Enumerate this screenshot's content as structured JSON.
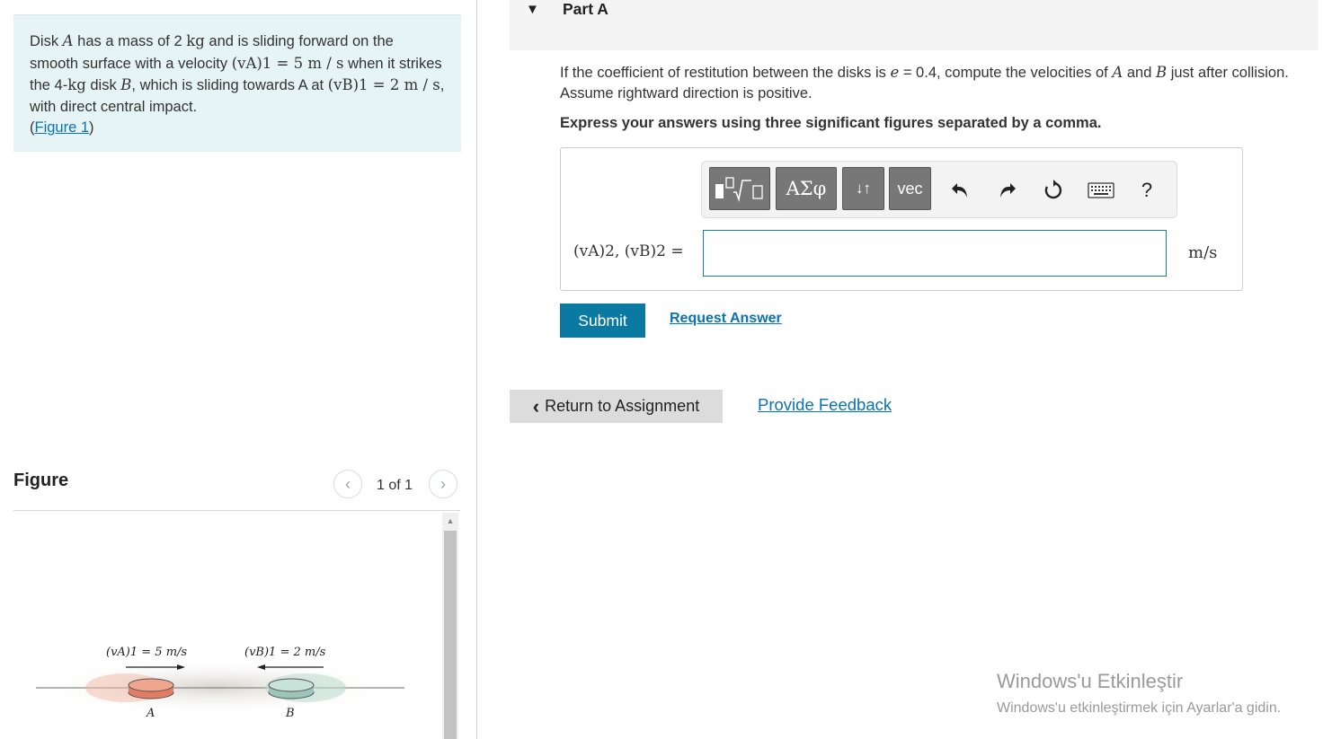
{
  "problem": {
    "text_1": "Disk ",
    "var_A": "A",
    "text_2": " has a mass of 2 ",
    "unit_kg": "kg",
    "text_3": " and is sliding forward on the smooth surface with a velocity ",
    "vA1": "(vA)1 = 5 m / s",
    "text_4": " when it strikes the 4-",
    "unit_kg2": "kg",
    "text_5": " disk ",
    "var_B": "B",
    "text_6": ", which is sliding towards A at ",
    "vB1": "(vB)1 = 2 m / s",
    "text_7": ", with direct central impact.",
    "figure_open": "(",
    "figure_link": "Figure 1",
    "figure_close": ")"
  },
  "figure": {
    "title": "Figure",
    "counter": "1 of 1",
    "label_vA": "(vA)1 = 5 m/s",
    "label_vB": "(vB)1 = 2 m/s",
    "disk_A_label": "A",
    "disk_B_label": "B"
  },
  "part": {
    "title": "Part A",
    "question_1": "If the coefficient of restitution between the disks is ",
    "e_var": "e",
    "question_2": " = 0.4, compute the velocities of ",
    "var_A": "A",
    "question_3": " and ",
    "var_B": "B",
    "question_4": " just after collision. Assume rightward direction is positive.",
    "instruction": "Express your answers using three significant figures separated by a comma."
  },
  "toolbar": {
    "greek": "ΑΣφ",
    "arrows": "↓↑",
    "vec": "vec",
    "help": "?"
  },
  "answer": {
    "label": "(vA)2, (vB)2 =",
    "value": "",
    "unit": "m/s"
  },
  "buttons": {
    "submit": "Submit",
    "request_answer": "Request Answer",
    "return": "Return to Assignment",
    "feedback": "Provide Feedback"
  },
  "watermark": {
    "title": "Windows'u Etkinleştir",
    "subtitle": "Windows'u etkinleştirmek için Ayarlar'a gidin."
  }
}
